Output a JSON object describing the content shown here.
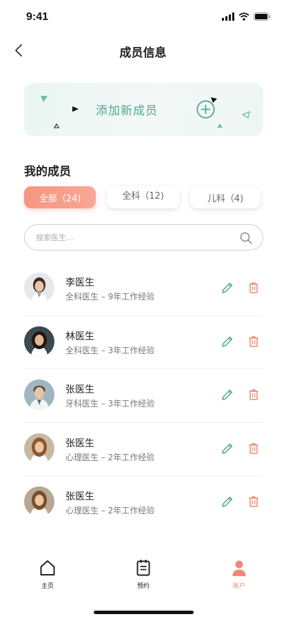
{
  "status_bar": {
    "time": "9:41"
  },
  "nav": {
    "title": "成员信息",
    "back_icon": "chevron-left-icon"
  },
  "add_member": {
    "label": "添加新成员",
    "icon": "plus-circle-icon",
    "accent": "#4fa895"
  },
  "section": {
    "title": "我的成员"
  },
  "filters": [
    {
      "label": "全部（24)",
      "active": true
    },
    {
      "label": "全科（12)",
      "active": false
    },
    {
      "label": "儿科（4)",
      "active": false
    }
  ],
  "search": {
    "placeholder": "搜索医生...",
    "icon": "search-icon"
  },
  "members": [
    {
      "name": "李医生",
      "detail": "全科医生 – 9年工作经验"
    },
    {
      "name": "林医生",
      "detail": "全科医生 – 3年工作经验"
    },
    {
      "name": "张医生",
      "detail": "牙科医生 – 3年工作经验"
    },
    {
      "name": "张医生",
      "detail": "心理医生 – 2年工作经验"
    },
    {
      "name": "张医生",
      "detail": "心理医生 – 2年工作经验"
    }
  ],
  "tabbar": {
    "items": [
      {
        "label": "主页",
        "icon": "home-icon",
        "active": false
      },
      {
        "label": "预约",
        "icon": "clipboard-icon",
        "active": false
      },
      {
        "label": "账户",
        "icon": "user-icon",
        "active": true
      }
    ]
  },
  "colors": {
    "primary": "#4fa895",
    "accent": "#f6957f",
    "delete": "#ef8a78"
  }
}
